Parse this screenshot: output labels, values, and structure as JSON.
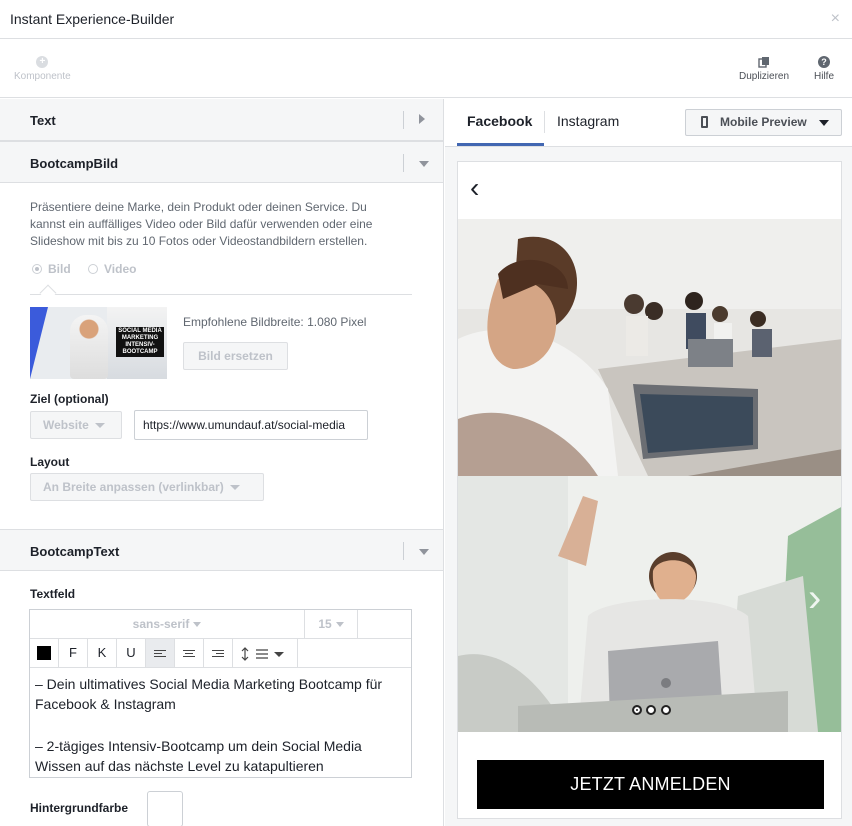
{
  "window": {
    "title": "Instant Experience-Builder",
    "close_glyph": "×"
  },
  "toolbar": {
    "add_component": {
      "label": "Komponente",
      "icon": "plus-circle-icon"
    },
    "duplicate": {
      "label": "Duplizieren",
      "icon": "duplicate-icon"
    },
    "help": {
      "label": "Hilfe",
      "icon": "question-circle-icon",
      "glyph": "?"
    },
    "add_glyph": "+"
  },
  "sections": {
    "text": {
      "title": "Text"
    },
    "image": {
      "title": "BootcampBild",
      "description": "Präsentiere deine Marke, dein Produkt oder deinen Service. Du kannst ein auffälliges Video oder Bild dafür verwenden oder eine Slideshow mit bis zu 10 Fotos oder Videostandbildern erstellen.",
      "media_options": [
        "Bild",
        "Video"
      ],
      "media_selected": "Bild",
      "thumb_caption": "SOCIAL MEDIA MARKETING INTENSIV-BOOTCAMP",
      "recommended_width": "Empfohlene Bildbreite: 1.080 Pixel",
      "replace_button": "Bild ersetzen",
      "destination_label": "Ziel (optional)",
      "destination_type": "Website",
      "destination_url": "https://www.umundauf.at/social-media",
      "layout_label": "Layout",
      "layout_value": "An Breite anpassen (verlinkbar)"
    },
    "textblock": {
      "title": "BootcampText",
      "field_label": "Textfeld",
      "font_family": "sans-serif",
      "font_size": "15",
      "format_buttons": {
        "bold": "F",
        "italic": "K",
        "underline": "U"
      },
      "paragraphs": [
        "– Dein ultimatives Social Media Marketing Bootcamp für Facebook & Instagram",
        "– 2-tägiges Intensiv-Bootcamp um dein Social Media Wissen auf das nächste Level zu katapultieren"
      ],
      "bg_label": "Hintergrundfarbe",
      "text_color": "#000000"
    }
  },
  "preview": {
    "tabs": [
      "Facebook",
      "Instagram"
    ],
    "active_tab": "Facebook",
    "device_button": "Mobile Preview",
    "back_glyph": "‹",
    "next_glyph": "›",
    "carousel_index": 1,
    "carousel_count": 3,
    "cta_label": "JETZT ANMELDEN"
  },
  "colors": {
    "accent": "#4267b2",
    "section_bg": "#f5f6f7",
    "cta_bg": "#000000"
  }
}
